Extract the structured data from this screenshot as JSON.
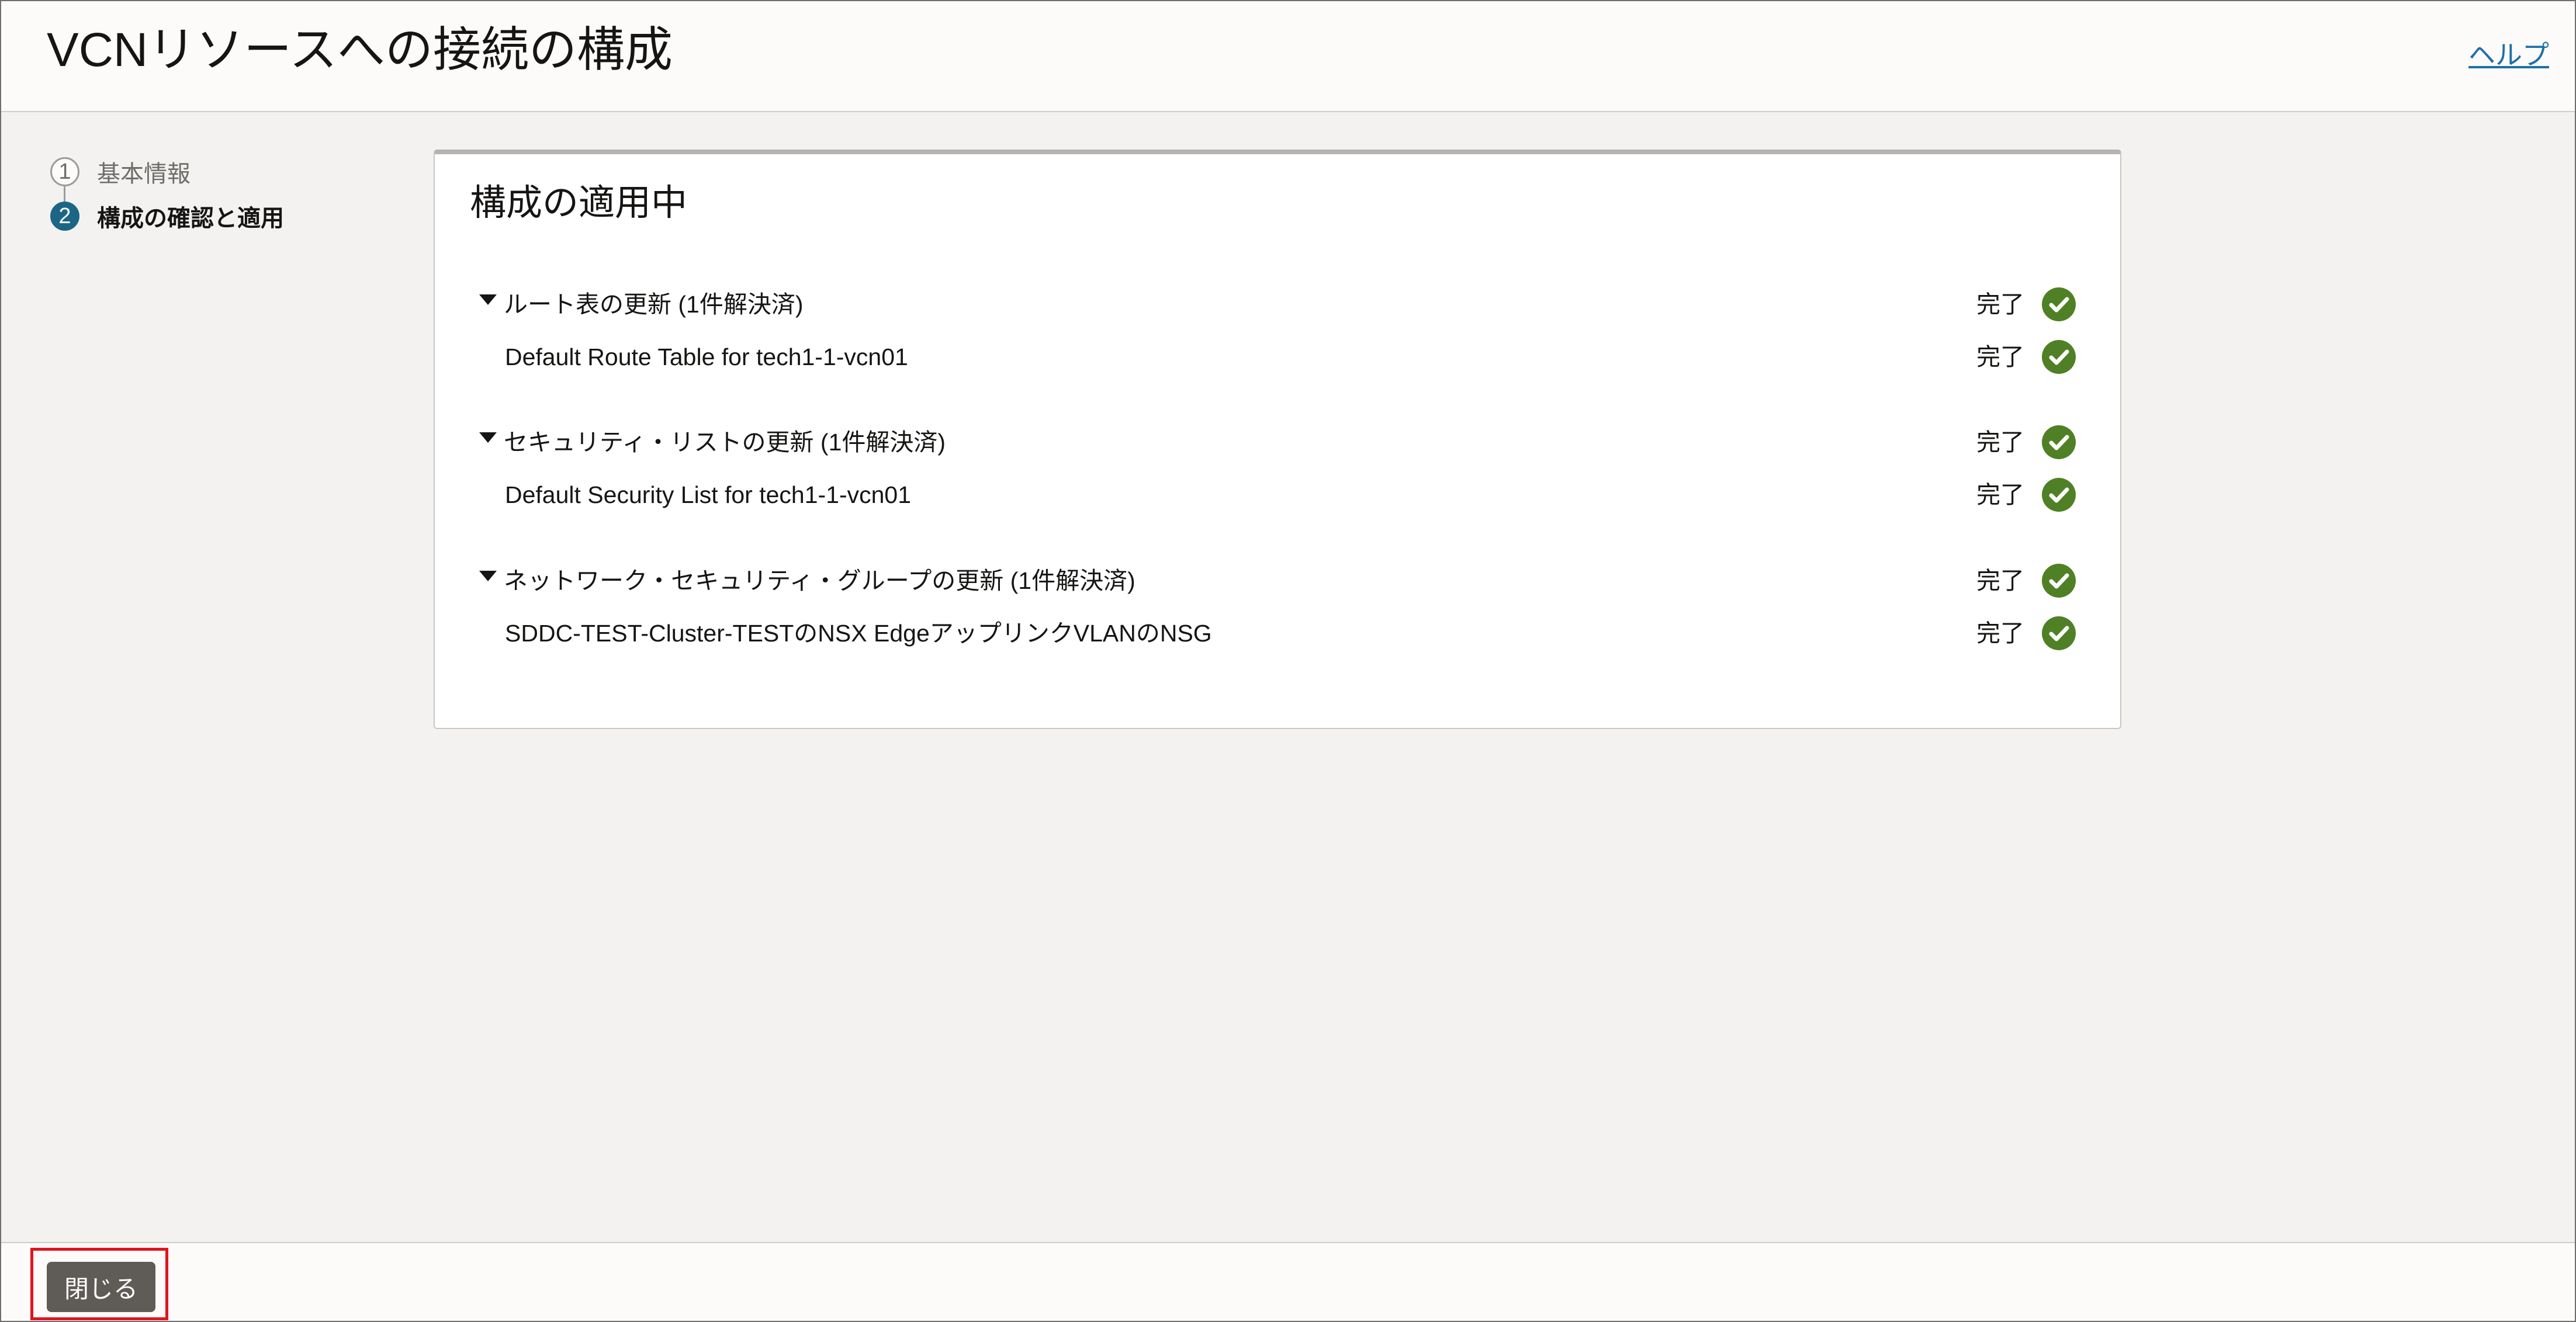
{
  "header": {
    "title": "VCNリソースへの接続の構成",
    "help_label": "ヘルプ"
  },
  "steps": [
    {
      "number": "1",
      "label": "基本情報",
      "state": "completed"
    },
    {
      "number": "2",
      "label": "構成の確認と適用",
      "state": "current"
    }
  ],
  "panel": {
    "title": "構成の適用中",
    "groups": [
      {
        "label": "ルート表の更新 (1件解決済)",
        "status": "完了",
        "items": [
          {
            "label": "Default Route Table for tech1-1-vcn01",
            "status": "完了"
          }
        ]
      },
      {
        "label": "セキュリティ・リストの更新 (1件解決済)",
        "status": "完了",
        "items": [
          {
            "label": "Default Security List for tech1-1-vcn01",
            "status": "完了"
          }
        ]
      },
      {
        "label": "ネットワーク・セキュリティ・グループの更新 (1件解決済)",
        "status": "完了",
        "items": [
          {
            "label": "SDDC-TEST-Cluster-TESTのNSX EdgeアップリンクVLANのNSG",
            "status": "完了"
          }
        ]
      }
    ]
  },
  "footer": {
    "close_label": "閉じる"
  },
  "colors": {
    "success": "#508025",
    "active_step": "#1c6685",
    "link": "#1e6fa8",
    "highlight": "#e0141e"
  },
  "icons": {
    "status": "check-circle-icon",
    "expand": "caret-down-icon"
  }
}
